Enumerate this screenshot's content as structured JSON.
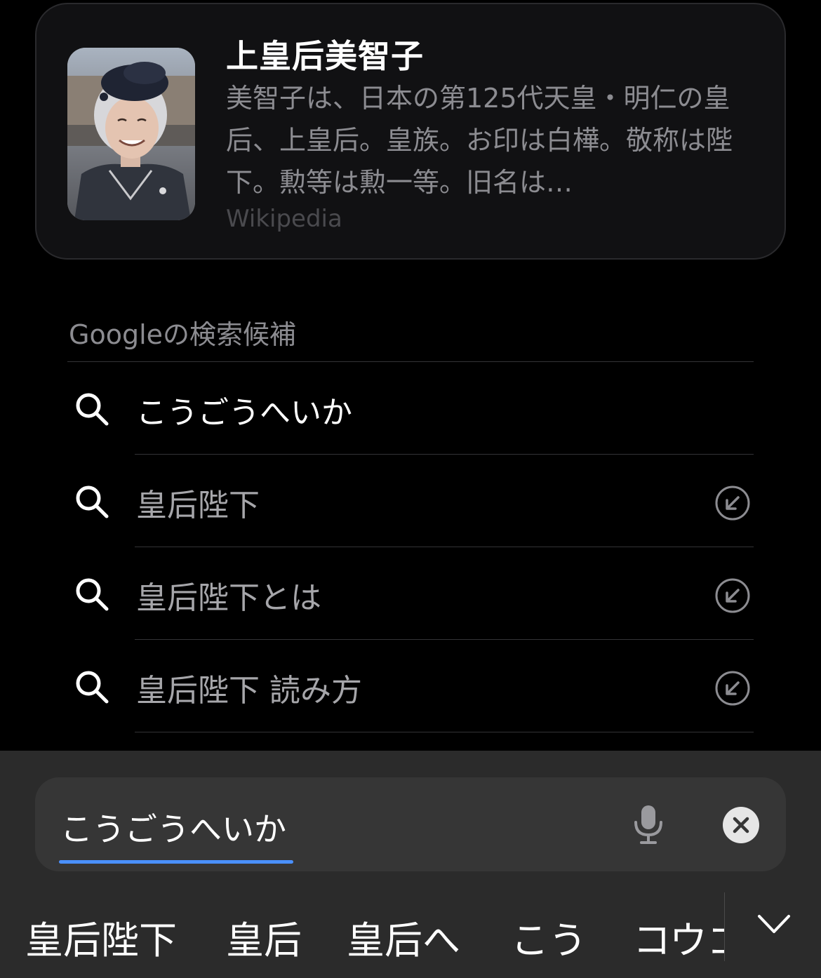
{
  "knowledge_card": {
    "title": "上皇后美智子",
    "description": "美智子は、日本の第125代天皇・明仁の皇后、上皇后。皇族。お印は白樺。敬称は陛下。勲等は勲一等。旧名は…",
    "source": "Wikipedia",
    "photo_icon": "person-photo"
  },
  "suggestions": {
    "header": "Googleの検索候補",
    "items": [
      {
        "text": "こうごうへいか",
        "has_fill_button": false
      },
      {
        "text": "皇后陛下",
        "has_fill_button": true
      },
      {
        "text": "皇后陛下とは",
        "has_fill_button": true
      },
      {
        "text": "皇后陛下 読み方",
        "has_fill_button": true
      }
    ]
  },
  "search": {
    "value": "こうごうへいか",
    "underline_color": "#4a90ff",
    "mic_icon": "microphone-icon",
    "clear_icon": "clear-icon"
  },
  "keyboard_candidates": {
    "items": [
      "皇后陛下",
      "皇后",
      "皇后へ",
      "こう",
      "コウゴ"
    ],
    "expand_icon": "chevron-down-icon"
  }
}
